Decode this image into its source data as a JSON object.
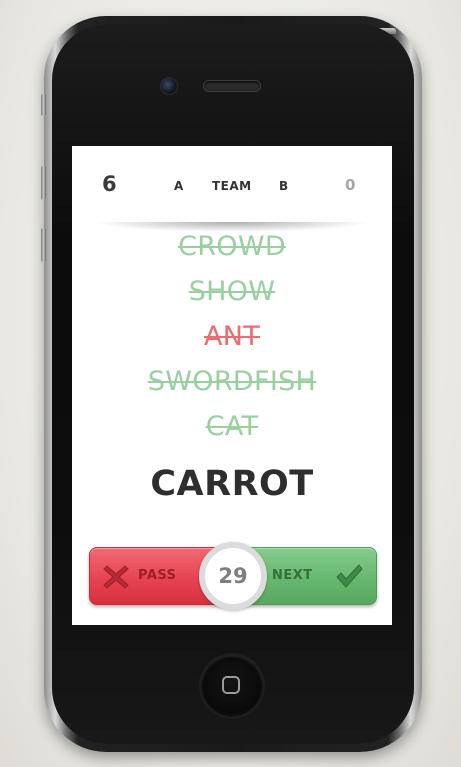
{
  "scoreboard": {
    "team_a_score": "6",
    "team_a_label": "A",
    "team_word": "TEAM",
    "team_b_label": "B",
    "team_b_score": "0"
  },
  "words": [
    {
      "text": "CROWD",
      "status": "done"
    },
    {
      "text": "SHOW",
      "status": "done"
    },
    {
      "text": "ANT",
      "status": "passed"
    },
    {
      "text": "SWORDFISH",
      "status": "done"
    },
    {
      "text": "CAT",
      "status": "done"
    }
  ],
  "current_word": "CARROT",
  "controls": {
    "pass_label": "PASS",
    "next_label": "NEXT",
    "timer": "29"
  },
  "icons": {
    "pass": "x-icon",
    "next": "check-icon"
  },
  "colors": {
    "done_word": "#9acf9f",
    "passed_word": "#ee6b6e",
    "pass_button": "#e84352",
    "next_button": "#67b86f"
  }
}
